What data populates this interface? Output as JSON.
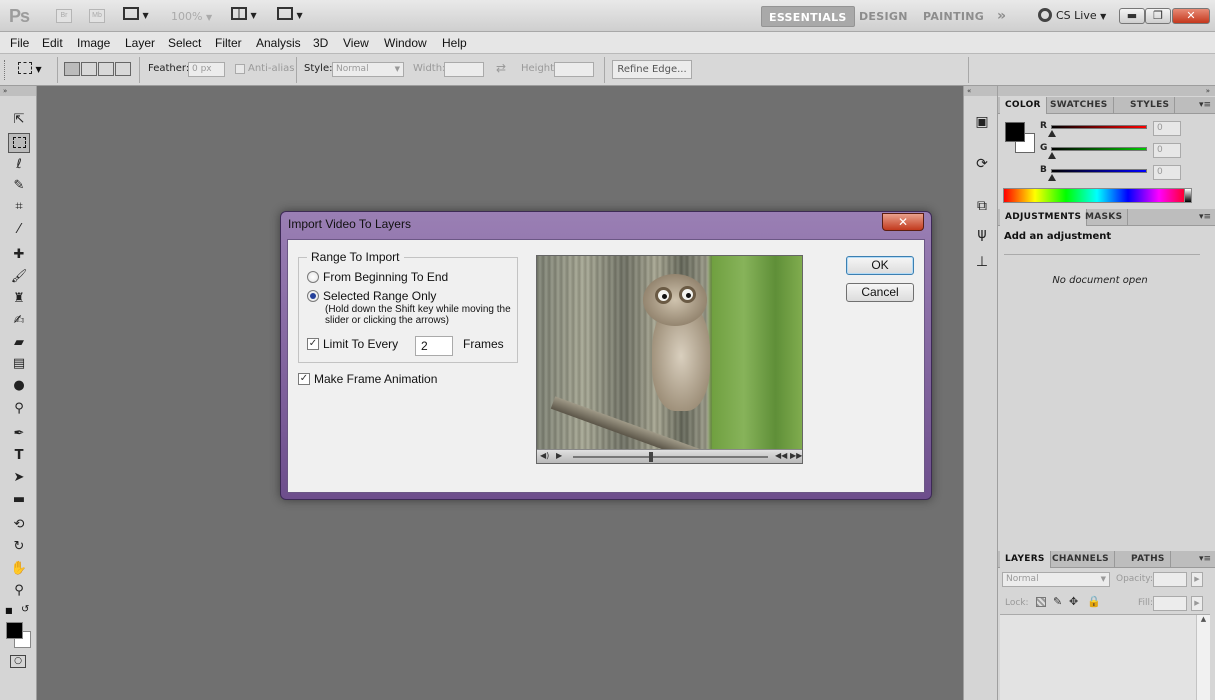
{
  "appbar": {
    "logo": "Ps",
    "bridge_label": "Br",
    "minibridge_label": "Mb",
    "zoom": "100%",
    "workspaces": [
      "ESSENTIALS",
      "DESIGN",
      "PAINTING"
    ],
    "more": "»",
    "cs_live": "CS Live"
  },
  "menu": [
    "File",
    "Edit",
    "Image",
    "Layer",
    "Select",
    "Filter",
    "Analysis",
    "3D",
    "View",
    "Window",
    "Help"
  ],
  "options": {
    "feather_label": "Feather:",
    "feather_value": "0 px",
    "antialias_label": "Anti-alias",
    "style_label": "Style:",
    "style_value": "Normal",
    "width_label": "Width:",
    "height_label": "Height:",
    "refine_edge": "Refine Edge..."
  },
  "panels": {
    "color_tabs": [
      "COLOR",
      "SWATCHES",
      "STYLES"
    ],
    "color_sliders": [
      {
        "label": "R",
        "value": "0"
      },
      {
        "label": "G",
        "value": "0"
      },
      {
        "label": "B",
        "value": "0"
      }
    ],
    "adjust_tabs": [
      "ADJUSTMENTS",
      "MASKS"
    ],
    "adjust_title": "Add an adjustment",
    "no_document": "No document open",
    "layers_tabs": [
      "LAYERS",
      "CHANNELS",
      "PATHS"
    ],
    "blend_mode": "Normal",
    "opacity_label": "Opacity:",
    "lock_label": "Lock:",
    "fill_label": "Fill:"
  },
  "dialog": {
    "title": "Import Video To Layers",
    "close": "✕",
    "range_legend": "Range To Import",
    "option_all": "From Beginning To End",
    "option_selected": "Selected Range Only",
    "hint_line1": "(Hold down the Shift key while moving the",
    "hint_line2": "slider or clicking the arrows)",
    "limit_label": "Limit To Every",
    "limit_value": "2",
    "frames_label": "Frames",
    "make_animation": "Make Frame Animation",
    "ok": "OK",
    "cancel": "Cancel",
    "selected_option": "selected_range",
    "limit_checked": true,
    "animation_checked": true,
    "playhead_fraction": 0.4
  }
}
